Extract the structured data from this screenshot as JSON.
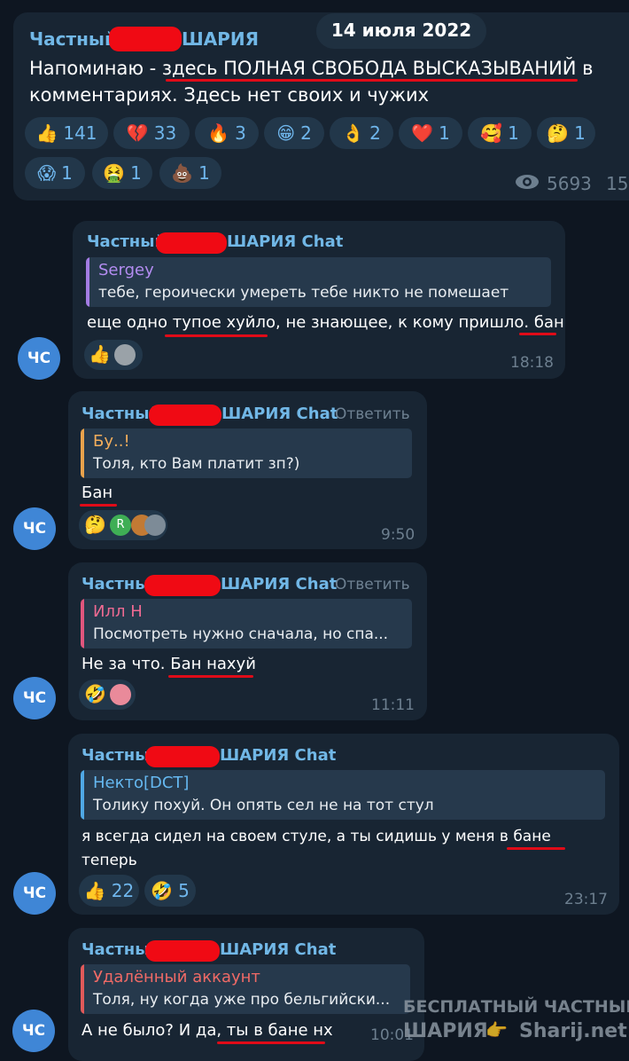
{
  "channel_post": {
    "channel_prefix": "Частный",
    "channel_suffix": "ШАРИЯ",
    "date_badge": "14 июля 2022",
    "text_line1": "Напоминаю - здесь ПОЛНАЯ СВОБОДА ВЫСКАЗЫВАНИЙ в",
    "text_line2": "комментариях. Здесь нет своих и чужих",
    "reactions": [
      {
        "emoji": "👍",
        "count": "141"
      },
      {
        "emoji": "💔",
        "count": "33"
      },
      {
        "emoji": "🔥",
        "count": "3"
      },
      {
        "emoji": "😁",
        "count": "2"
      },
      {
        "emoji": "👌",
        "count": "2"
      },
      {
        "emoji": "❤️",
        "count": "1"
      },
      {
        "emoji": "🥰",
        "count": "1"
      },
      {
        "emoji": "🤔",
        "count": "1"
      },
      {
        "emoji": "😱",
        "count": "1"
      },
      {
        "emoji": "🤮",
        "count": "1"
      },
      {
        "emoji": "💩",
        "count": "1"
      }
    ],
    "views": "5693",
    "time_partial": "15"
  },
  "comments": [
    {
      "sender_prefix": "Частный",
      "sender_suffix": "ШАРИЯ Chat",
      "quote_name": "Sergey",
      "quote_text": "тебе, героически умереть тебе никто не помешает",
      "text": "еще одно тупое хуйло, не знающее, к кому пришло. бан",
      "time": "18:18",
      "avatar": "ЧС"
    },
    {
      "sender_prefix": "Частный",
      "sender_suffix": "ШАРИЯ Chat",
      "reply_label": "Ответить",
      "quote_name": "Бу..!",
      "quote_text": "Толя, кто Вам платит зп?)",
      "text": "Бан",
      "time": "9:50",
      "avatar": "ЧС",
      "small_avatar_letter": "R"
    },
    {
      "sender_prefix": "Частный",
      "sender_suffix": "ШАРИЯ Chat",
      "reply_label": "Ответить",
      "quote_name": "Илл Н",
      "quote_text": "Посмотреть нужно сначала, но спа...",
      "text": "Не за что. Бан нахуй",
      "time": "11:11",
      "avatar": "ЧС"
    },
    {
      "sender_prefix": "Частный",
      "sender_suffix": "ШАРИЯ Chat",
      "quote_name": "Некто[DCT]",
      "quote_text": "Толику похуй. Он опять сел не на тот стул",
      "text_line1": "я всегда сидел на своем стуле, а ты сидишь у меня в бане",
      "text_line2": "теперь",
      "reactions": [
        {
          "emoji": "👍",
          "count": "22"
        },
        {
          "emoji": "🤣",
          "count": "5"
        }
      ],
      "time": "23:17",
      "avatar": "ЧС"
    },
    {
      "sender_prefix": "Частный",
      "sender_suffix": "ШАРИЯ Chat",
      "quote_name": "Удалённый аккаунт",
      "quote_text": "Толя, ну когда уже про бельгийски...",
      "text": "А не было? И да, ты в бане нх",
      "time": "10:01",
      "avatar": "ЧС"
    }
  ],
  "watermark": {
    "line1": "БЕСПЛАТНЫЙ ЧАСТНЫЙ",
    "line2_left": "ШАРИЯ",
    "line2_right": "Sharij.net"
  },
  "colors": {
    "background": "#0e1621",
    "bubble": "#182533",
    "accent": "#71b7e6",
    "redaction": "#f00a14"
  }
}
